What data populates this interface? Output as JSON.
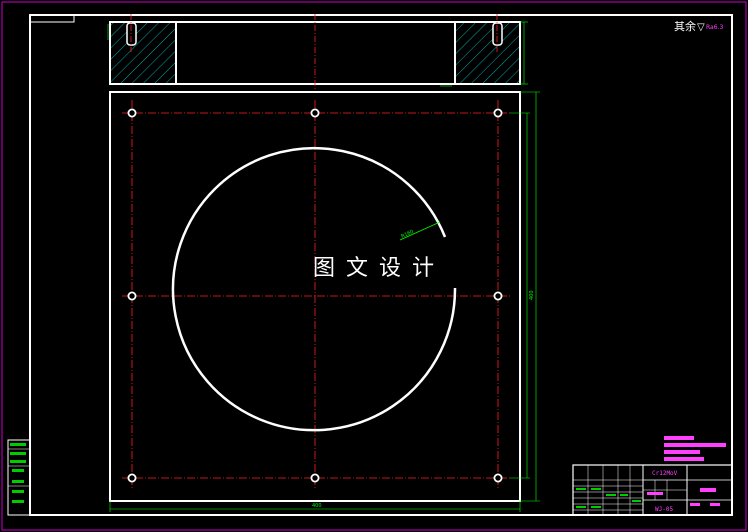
{
  "viewer": {
    "background": "#000000",
    "colors": {
      "outline": "#ffffff",
      "centerline": "#ff2020",
      "dimension": "#00ff00",
      "frame_outer": "#cc00cc",
      "title_text": "#ff40ff",
      "hatch": "#00aaaa"
    }
  },
  "drawing": {
    "watermark": "图 文 设 计",
    "roughness_note": "其余",
    "roughness_symbol": "▽",
    "roughness_value": "Ra6.3",
    "arc_label": "R160",
    "dimensions": {
      "overall_width": "400",
      "overall_height": "400"
    },
    "holes": {
      "count": 8
    }
  },
  "title_block": {
    "material": "Cr12MoV",
    "drawing_number": "WJ-05"
  }
}
